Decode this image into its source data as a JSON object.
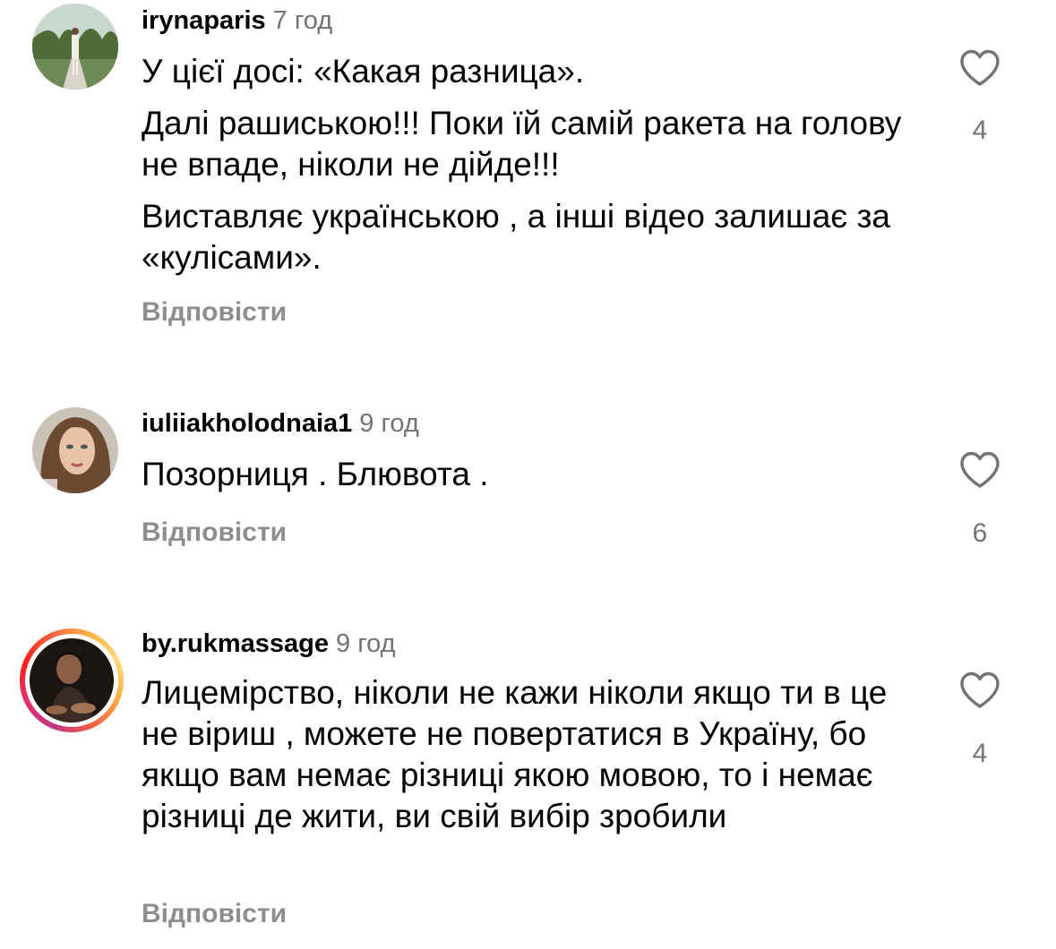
{
  "comments": [
    {
      "username": "irynaparis",
      "time": "7 год",
      "paragraphs": [
        "У цієї досі: «Какая разница».",
        "Далі рашиською!!! Поки їй самій ракета на голову не впаде, ніколи не дійде!!!",
        "Виставляє українською , а інші відео залишає за «кулісами»."
      ],
      "reply_label": "Відповісти",
      "likes": "4",
      "like_icon": "heart-outline-icon"
    },
    {
      "username": "iuliiakholodnaia1",
      "time": "9 год",
      "paragraphs": [
        "Позорниця . Блювота ."
      ],
      "reply_label": "Відповісти",
      "likes": "6",
      "like_icon": "heart-outline-icon"
    },
    {
      "username": "by.rukmassage",
      "time": "9 год",
      "paragraphs": [
        "Лицемірство, ніколи не кажи ніколи якщо ти в це не віриш , можете не повертатися в Україну, бо якщо вам немає різниці якою мовою, то і немає різниці де жити, ви свій вибір зробили"
      ],
      "reply_label": "Відповісти",
      "likes": "4",
      "like_icon": "heart-outline-icon",
      "has_story_ring": true
    }
  ],
  "colors": {
    "text": "#000000",
    "secondary": "#737373",
    "reply": "#8e8e8e",
    "background": "#ffffff"
  }
}
